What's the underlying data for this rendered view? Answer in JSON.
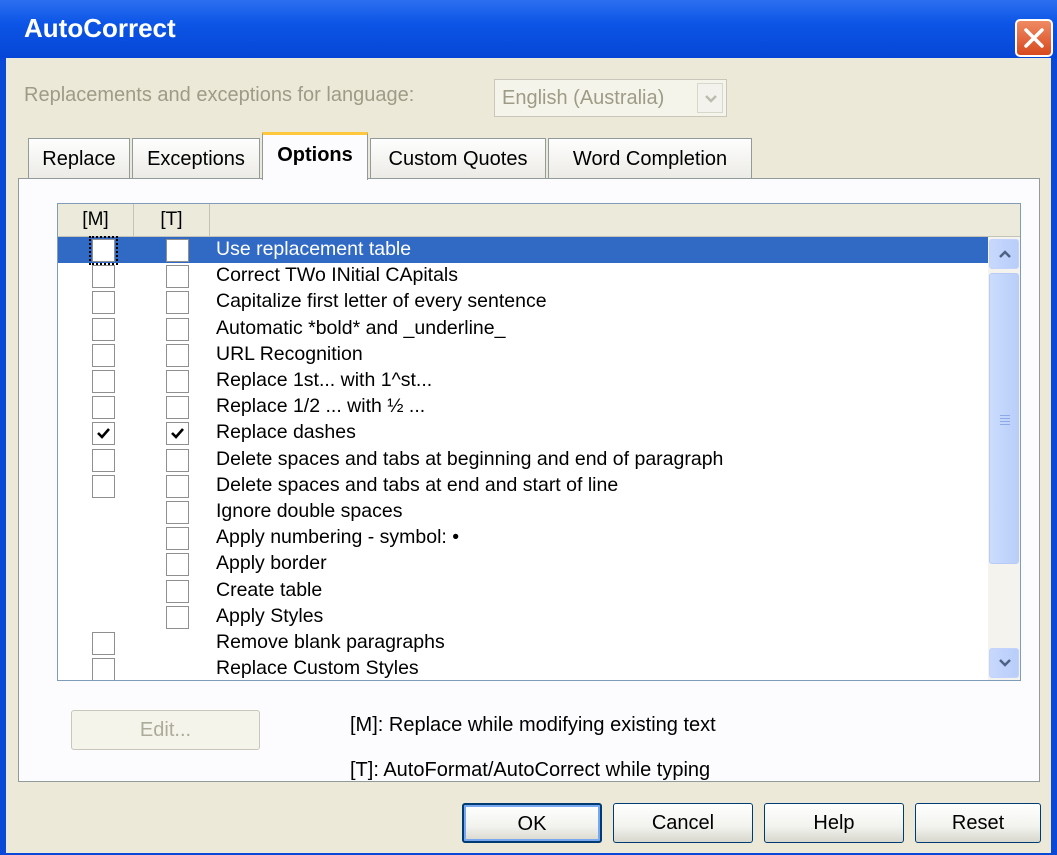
{
  "window": {
    "title": "AutoCorrect"
  },
  "language": {
    "label": "Replacements and exceptions for language:",
    "value": "English (Australia)"
  },
  "tabs": [
    {
      "label": "Replace",
      "active": false
    },
    {
      "label": "Exceptions",
      "active": false
    },
    {
      "label": "Options",
      "active": true
    },
    {
      "label": "Custom Quotes",
      "active": false
    },
    {
      "label": "Word Completion",
      "active": false
    }
  ],
  "list": {
    "headers": {
      "m": "[M]",
      "t": "[T]"
    },
    "rows": [
      {
        "label": "Use replacement table",
        "m": false,
        "t": false,
        "selected": true
      },
      {
        "label": "Correct TWo INitial CApitals",
        "m": false,
        "t": false
      },
      {
        "label": "Capitalize first letter of every sentence",
        "m": false,
        "t": false
      },
      {
        "label": "Automatic *bold* and _underline_",
        "m": false,
        "t": false
      },
      {
        "label": "URL Recognition",
        "m": false,
        "t": false
      },
      {
        "label": "Replace 1st... with 1^st...",
        "m": false,
        "t": false
      },
      {
        "label": "Replace 1/2 ... with ½ ...",
        "m": false,
        "t": false
      },
      {
        "label": "Replace dashes",
        "m": true,
        "t": true
      },
      {
        "label": "Delete spaces and tabs at beginning and end of paragraph",
        "m": false,
        "t": false
      },
      {
        "label": "Delete spaces and tabs at end and start of line",
        "m": false,
        "t": false
      },
      {
        "label": "Ignore double spaces",
        "m": null,
        "t": false
      },
      {
        "label": "Apply numbering - symbol: •",
        "m": null,
        "t": false
      },
      {
        "label": "Apply border",
        "m": null,
        "t": false
      },
      {
        "label": "Create table",
        "m": null,
        "t": false
      },
      {
        "label": "Apply Styles",
        "m": null,
        "t": false
      },
      {
        "label": "Remove blank paragraphs",
        "m": false,
        "t": null
      },
      {
        "label": "Replace Custom Styles",
        "m": false,
        "t": null
      }
    ]
  },
  "edit_button": "Edit...",
  "legend": {
    "m": "[M]: Replace while modifying existing text",
    "t": "[T]: AutoFormat/AutoCorrect while typing"
  },
  "buttons": {
    "ok": "OK",
    "cancel": "Cancel",
    "help": "Help",
    "reset": "Reset"
  }
}
